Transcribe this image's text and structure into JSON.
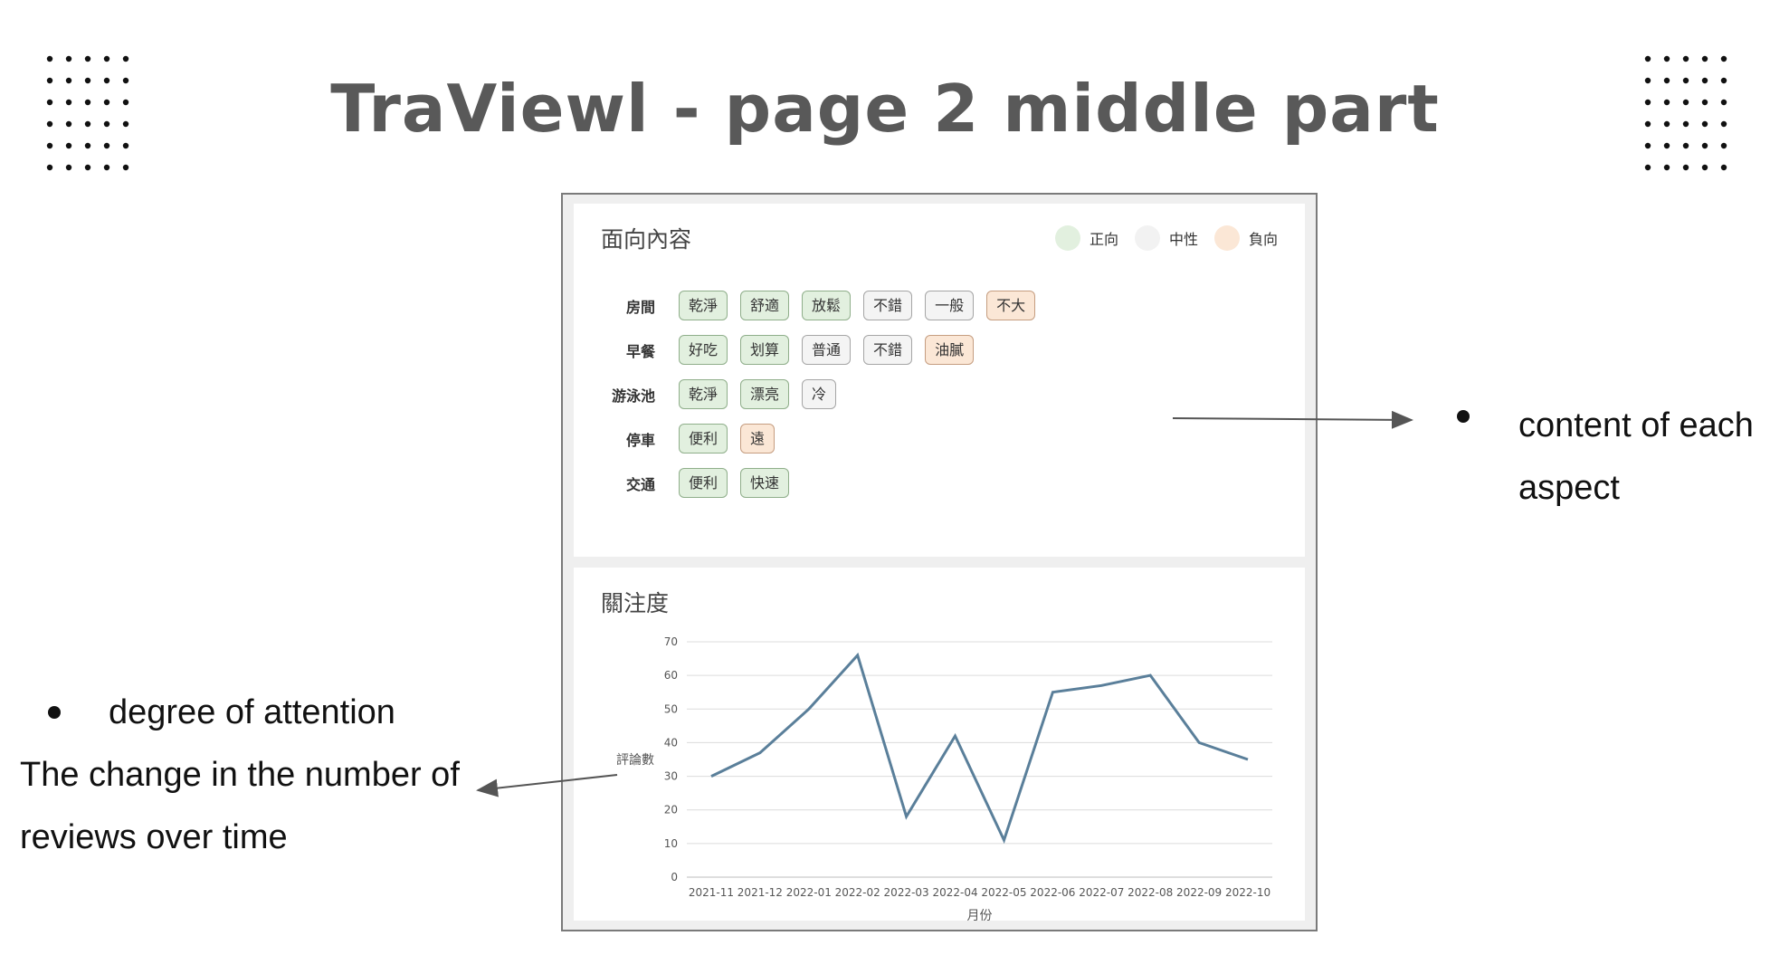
{
  "slide": {
    "title": "TraViewl - page 2 middle part"
  },
  "aspect_panel": {
    "title": "面向內容",
    "legend": [
      {
        "label": "正向",
        "color": "#e2f0df"
      },
      {
        "label": "中性",
        "color": "#f2f2f2"
      },
      {
        "label": "負向",
        "color": "#fbe7d6"
      }
    ],
    "aspects": [
      {
        "name": "房間",
        "tags": [
          {
            "text": "乾淨",
            "sentiment": "positive"
          },
          {
            "text": "舒適",
            "sentiment": "positive"
          },
          {
            "text": "放鬆",
            "sentiment": "positive"
          },
          {
            "text": "不錯",
            "sentiment": "neutral"
          },
          {
            "text": "一般",
            "sentiment": "neutral"
          },
          {
            "text": "不大",
            "sentiment": "negative"
          }
        ]
      },
      {
        "name": "早餐",
        "tags": [
          {
            "text": "好吃",
            "sentiment": "positive"
          },
          {
            "text": "划算",
            "sentiment": "positive"
          },
          {
            "text": "普通",
            "sentiment": "neutral"
          },
          {
            "text": "不錯",
            "sentiment": "neutral"
          },
          {
            "text": "油膩",
            "sentiment": "negative"
          }
        ]
      },
      {
        "name": "游泳池",
        "tags": [
          {
            "text": "乾淨",
            "sentiment": "positive"
          },
          {
            "text": "漂亮",
            "sentiment": "positive"
          },
          {
            "text": "冷",
            "sentiment": "neutral"
          }
        ]
      },
      {
        "name": "停車",
        "tags": [
          {
            "text": "便利",
            "sentiment": "positive"
          },
          {
            "text": "遠",
            "sentiment": "negative"
          }
        ]
      },
      {
        "name": "交通",
        "tags": [
          {
            "text": "便利",
            "sentiment": "positive"
          },
          {
            "text": "快速",
            "sentiment": "positive"
          }
        ]
      }
    ]
  },
  "attention_panel": {
    "title": "關注度"
  },
  "chart_data": {
    "type": "line",
    "title": "",
    "xlabel": "月份",
    "ylabel": "評論數",
    "categories": [
      "2021-11",
      "2021-12",
      "2022-01",
      "2022-02",
      "2022-03",
      "2022-04",
      "2022-05",
      "2022-06",
      "2022-07",
      "2022-08",
      "2022-09",
      "2022-10"
    ],
    "series": [
      {
        "values": [
          30,
          37,
          50,
          66,
          18,
          42,
          11,
          55,
          57,
          60,
          40,
          35
        ],
        "color": "#5a7f9a"
      }
    ],
    "ylim": [
      0,
      70
    ],
    "yticks": [
      0,
      10,
      20,
      30,
      40,
      50,
      60,
      70
    ],
    "grid": true,
    "legend": "none"
  },
  "annotations": {
    "right_bullet": "content of each aspect",
    "left_bullet": "degree of attention",
    "left_text": "The change in the number of reviews over time"
  }
}
